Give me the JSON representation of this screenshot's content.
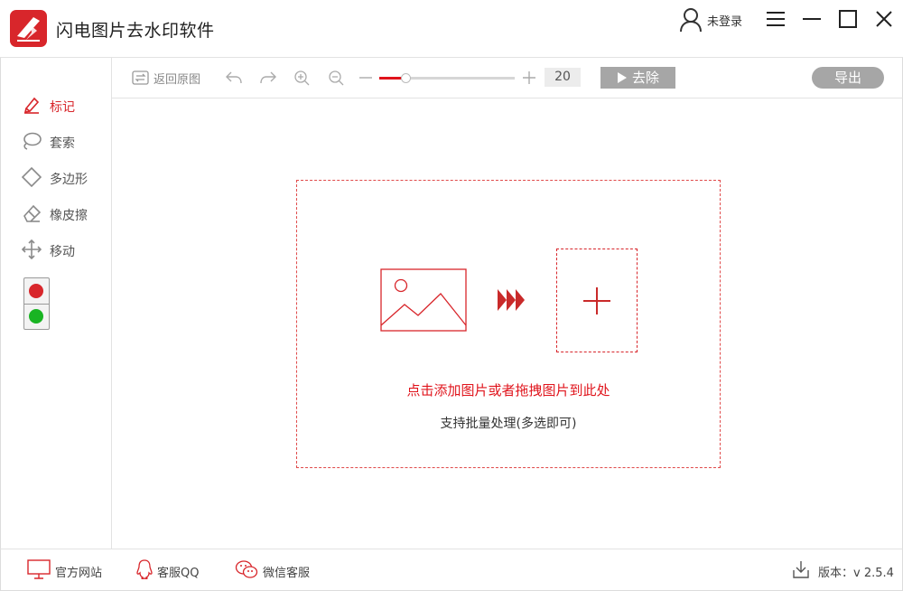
{
  "window": {
    "title": "闪电图片去水印软件",
    "user_label": "未登录",
    "buttons": [
      "menu",
      "minimize",
      "maximize",
      "close"
    ]
  },
  "sidebar": {
    "tools": [
      {
        "label": "标记",
        "icon": "marker-icon",
        "active": true
      },
      {
        "label": "套索",
        "icon": "lasso-icon",
        "active": false
      },
      {
        "label": "多边形",
        "icon": "polygon-icon",
        "active": false
      },
      {
        "label": "橡皮擦",
        "icon": "eraser-icon",
        "active": false
      },
      {
        "label": "移动",
        "icon": "move-icon",
        "active": false
      }
    ],
    "colors": [
      "#d8262b",
      "#19b423"
    ]
  },
  "toolbar": {
    "back_label": "返回原图",
    "zoom_value": "20",
    "slider_fraction": 0.19,
    "remove_label": "去除",
    "export_label": "导出"
  },
  "dropzone": {
    "hint": "点击添加图片或者拖拽图片到此处",
    "subhint": "支持批量处理(多选即可)"
  },
  "footer": {
    "website": "官方网站",
    "qq": "客服QQ",
    "wechat": "微信客服",
    "version": "版本：v 2.5.4"
  },
  "colors": {
    "accent": "#d8262b",
    "button_gray": "#a6a6a6",
    "border": "#e2e2e2"
  }
}
